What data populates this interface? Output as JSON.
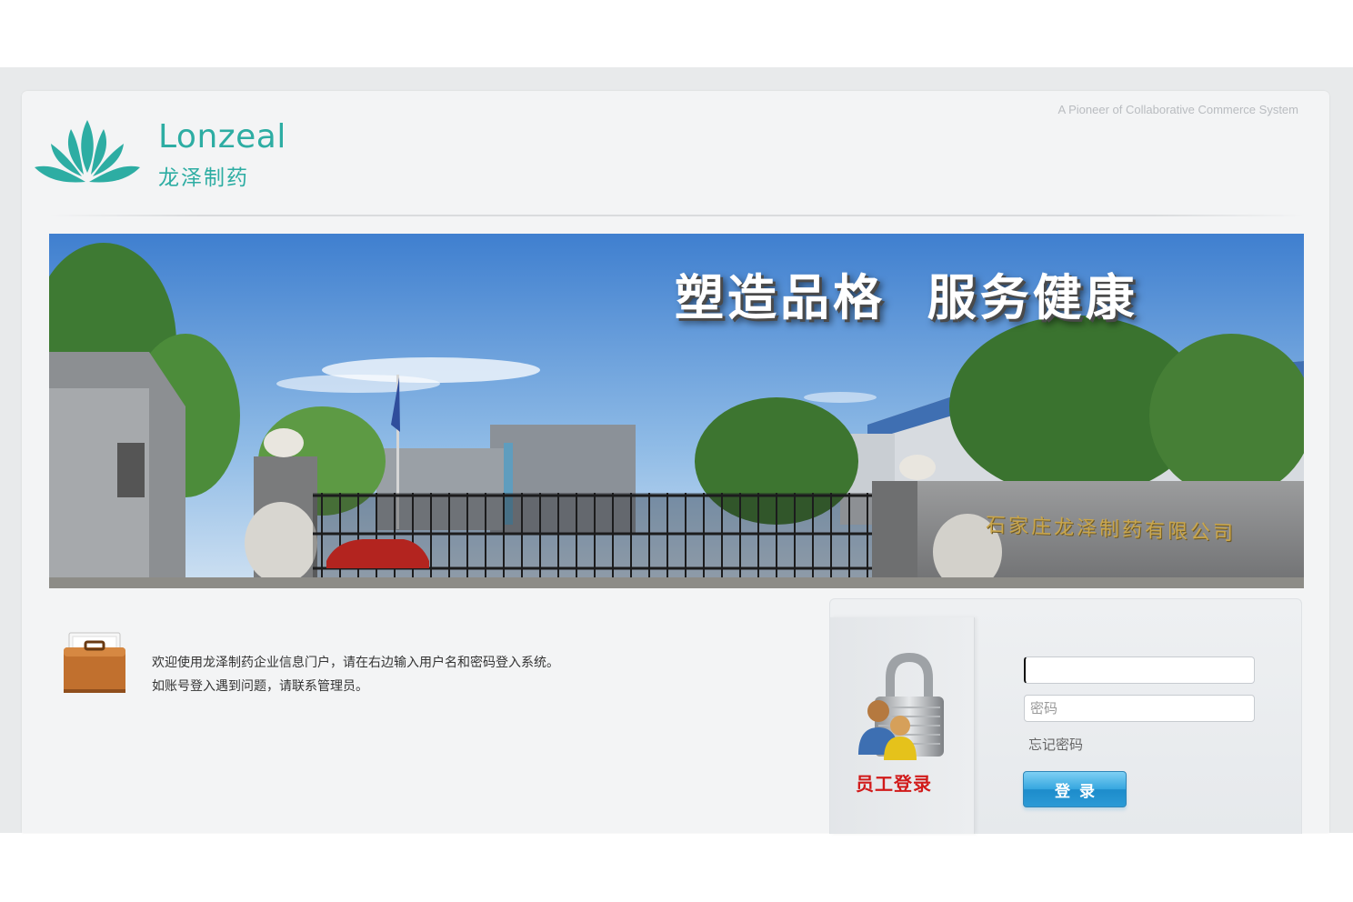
{
  "header": {
    "tagline": "A Pioneer of Collaborative Commerce System",
    "brand_en": "Lonzeal",
    "brand_cn": "龙泽制药",
    "logo_icon": "lotus-logo-icon",
    "brand_color": "#2dada3"
  },
  "banner": {
    "slogan": "塑造品格  服务健康",
    "wall_sign": "石家庄龙泽制药有限公司"
  },
  "welcome": {
    "icon": "briefcase-icon",
    "line1": "欢迎使用龙泽制药企业信息门户，请在右边输入用户名和密码登入系统。",
    "line2": "如账号登入遇到问题，请联系管理员。"
  },
  "login": {
    "icon": "padlock-users-icon",
    "title": "员工登录",
    "username_value": "",
    "password_placeholder": "密码",
    "forgot_label": "忘记密码",
    "submit_label": "登录",
    "title_color": "#d11a1a"
  }
}
